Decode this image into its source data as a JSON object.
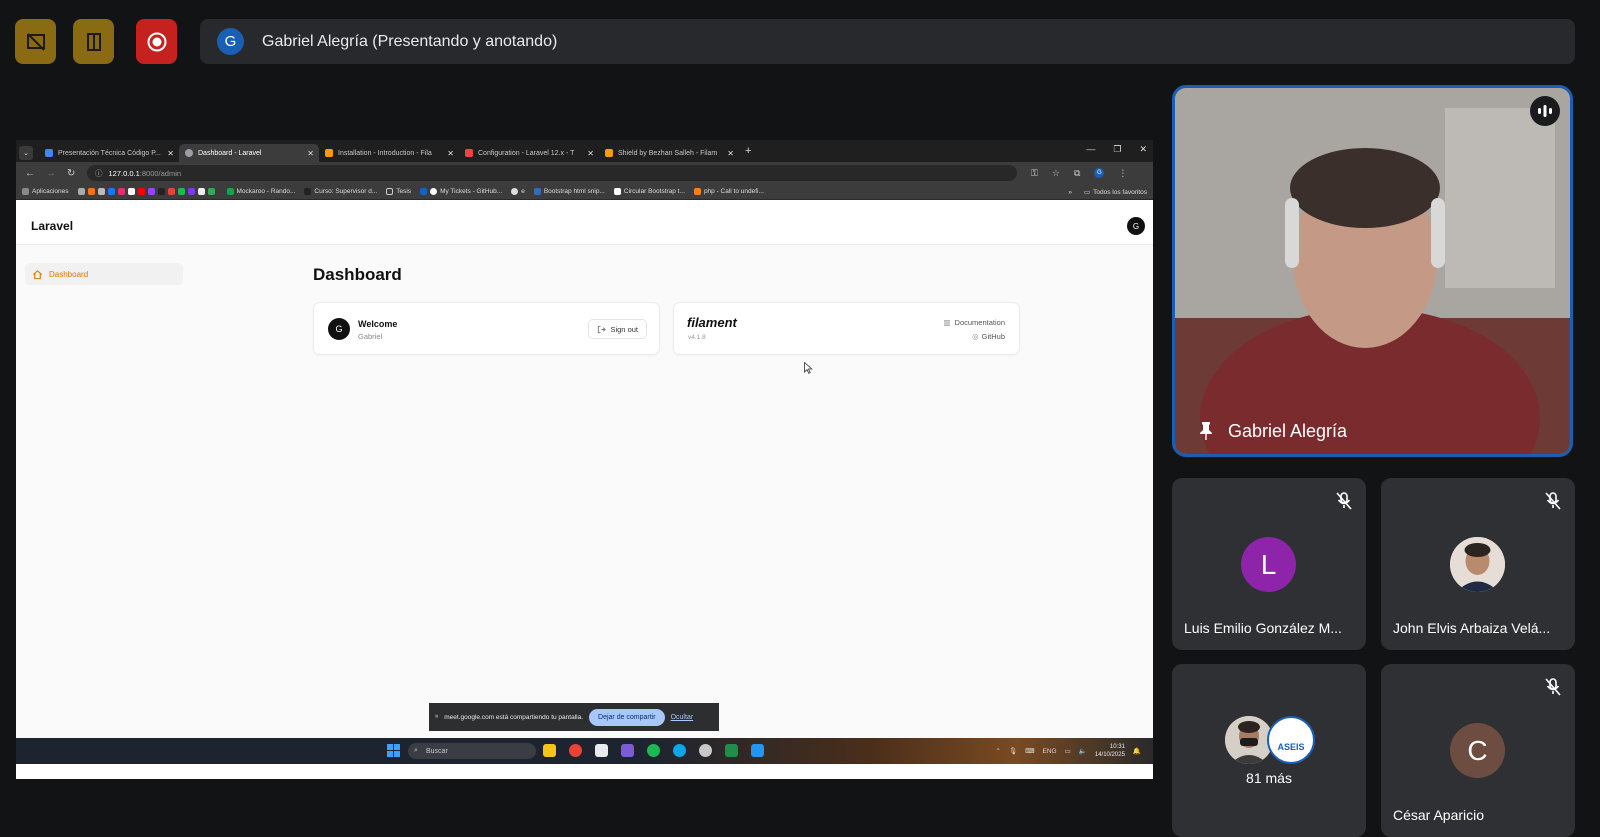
{
  "meet": {
    "presenter_initial": "G",
    "presenter_text": "Gabriel Alegría (Presentando y anotando)",
    "buttons": [
      "no-layout-icon",
      "door-icon",
      "record-icon"
    ],
    "colors": {
      "button_gold": "#8a6a12",
      "record_red": "#c5221f",
      "tile_bg": "#2f3033",
      "accent_blue": "#1a5fb4"
    }
  },
  "browser": {
    "tabs": [
      {
        "label": "Presentación Técnica Código P...",
        "color": "#4285f4"
      },
      {
        "label": "Dashboard - Laravel",
        "color": "#9aa0a6"
      },
      {
        "label": "Installation - Introduction - Fila",
        "color": "#f59e0b"
      },
      {
        "label": "Configuration - Laravel 12.x - T",
        "color": "#ef4444"
      },
      {
        "label": "Shield by Bezhan Salleh - Filam",
        "color": "#f59e0b"
      }
    ],
    "url_host": "127.0.0.1",
    "url_path": ":8000/admin",
    "profile_initial": "G",
    "bookmarks": [
      "Aplicaciones",
      "Mockaroo - Rando...",
      "Curso: Supervisor d...",
      "Tesis",
      "My Tickets - GitHub...",
      "e",
      "Bootstrap html snip...",
      "Circular Bootstrap t...",
      "php - Call to undefi..."
    ],
    "bookmarks_right": "Todos los favoritos"
  },
  "app": {
    "brand": "Laravel",
    "user_initial": "G",
    "sidebar_item": "Dashboard",
    "page_title": "Dashboard",
    "welcome_title": "Welcome",
    "welcome_user": "Gabriel",
    "welcome_initial": "G",
    "sign_out": "Sign out",
    "filament_logo": "filament",
    "filament_version": "v4.1.8",
    "documentation": "Documentation",
    "github": "GitHub"
  },
  "share_banner": {
    "text": "meet.google.com está compartiendo tu pantalla.",
    "stop": "Dejar de compartir",
    "hide": "Ocultar"
  },
  "taskbar": {
    "search": "Buscar",
    "lang": "ENG",
    "time": "10:31",
    "date": "14/10/2025"
  },
  "participants": {
    "self_name": "Gabriel Alegría",
    "tiles": [
      {
        "name": "Luis Emilio González M...",
        "initial": "L",
        "color": "#8e24aa",
        "muted": true
      },
      {
        "name": "John Elvis Arbaiza Velá...",
        "initial": "",
        "color": "#c9b8a8",
        "muted": true
      },
      {
        "name": "",
        "initial": "",
        "color": "",
        "muted": false
      },
      {
        "name": "César Aparicio",
        "initial": "C",
        "color": "#6d4c41",
        "muted": true
      }
    ],
    "more_label": "81 más",
    "aseis_label": "ASEIS"
  }
}
